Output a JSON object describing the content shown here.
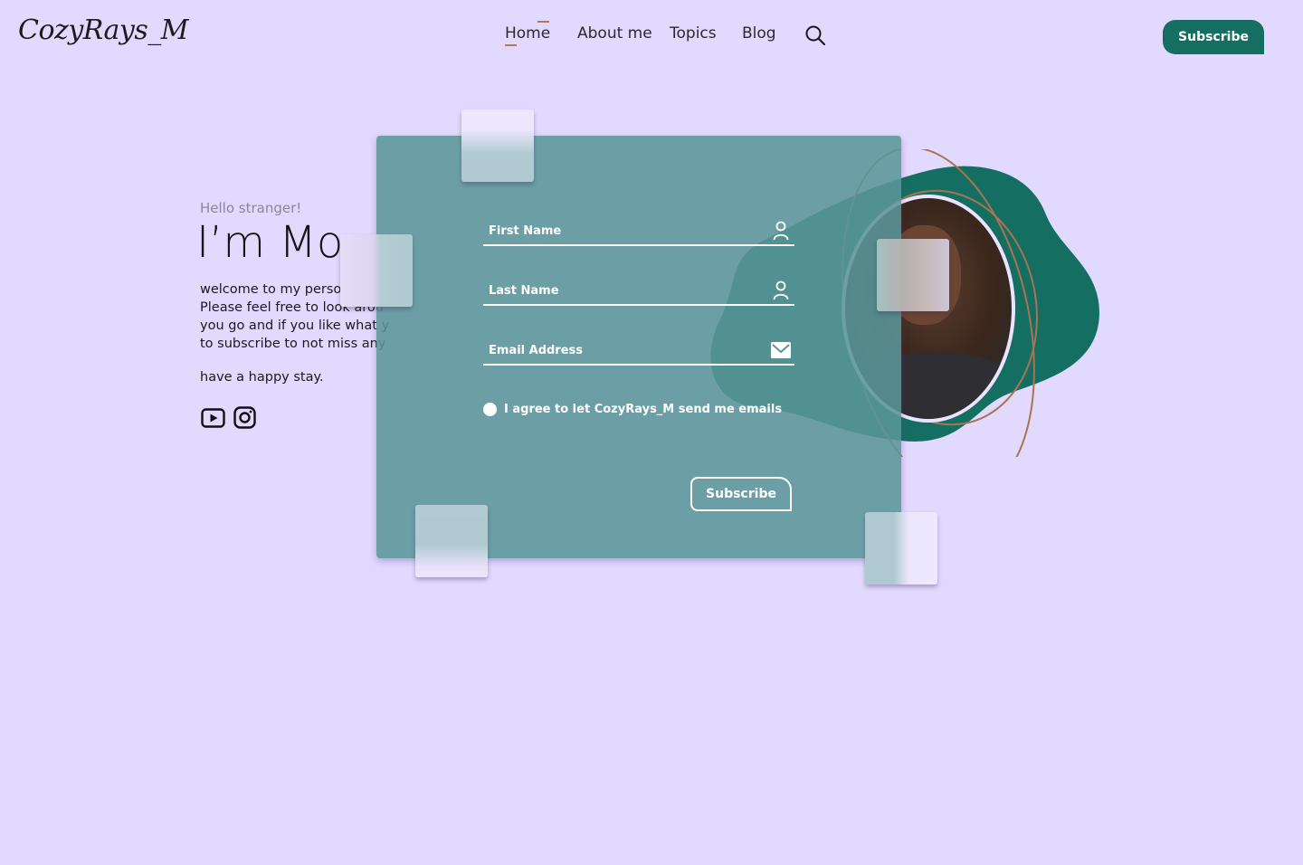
{
  "header": {
    "logo_text": "CozyRays_M",
    "nav": [
      "Home",
      "About me",
      "Topics",
      "Blog"
    ],
    "active_nav": "Home",
    "search_icon": "search-icon",
    "subscribe_label": "Subscribe"
  },
  "hero": {
    "greeting": "Hello stranger!",
    "name_visible": "I’m Mo",
    "intro_lines": [
      "welcome to my person",
      "Please feel free to look arou",
      "you go and if you like what y",
      "to subscribe to not miss any"
    ],
    "closing": "have a happy stay.",
    "social_icons": [
      "youtube-icon",
      "instagram-icon"
    ]
  },
  "form": {
    "first_name_label": "First Name",
    "last_name_label": "Last Name",
    "email_label": "Email Address",
    "agree_label": "I agree to let CozyRays_M send me emails",
    "subscribe_label": "Subscribe"
  },
  "colors": {
    "background": "#e2d9fe",
    "brand_green": "#146f62",
    "card_teal": "#5a9698",
    "accent_brown": "#b07b52"
  }
}
